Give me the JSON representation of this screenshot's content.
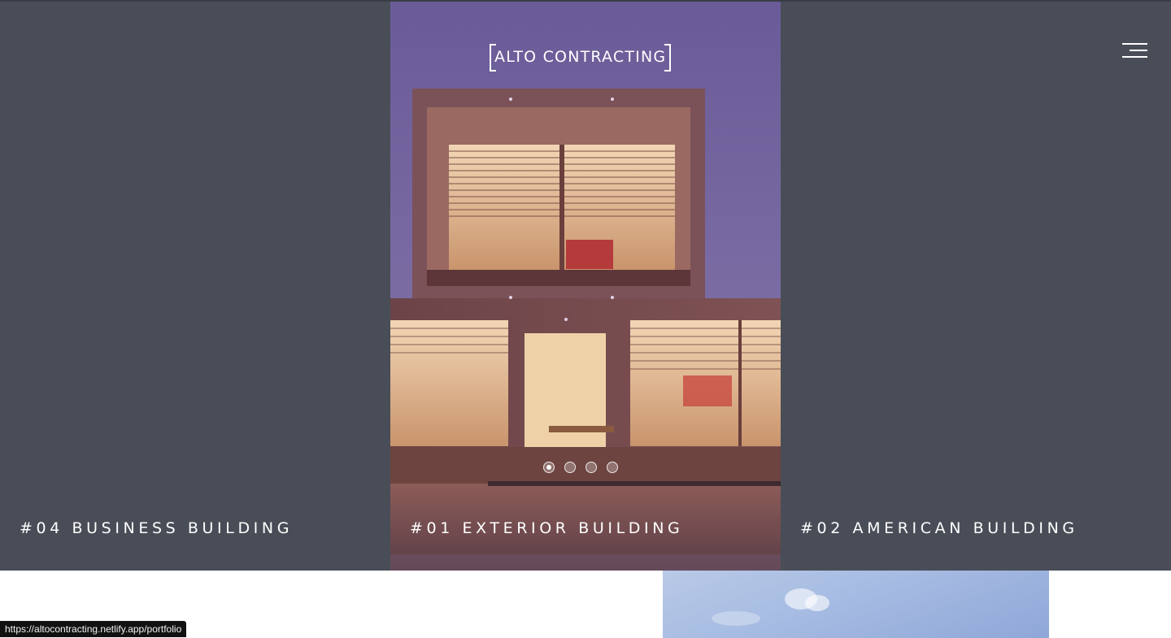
{
  "brand": {
    "logo_text": "ALTO CONTRACTING"
  },
  "header": {
    "menu_icon": "hamburger-menu-icon"
  },
  "slider": {
    "panels": [
      {
        "label": "#04 BUSINESS BUILDING"
      },
      {
        "label": "#01 EXTERIOR BUILDING"
      },
      {
        "label": "#02 AMERICAN BUILDING"
      }
    ],
    "dots": 4,
    "active_dot": 1
  },
  "status_bar": {
    "url": "https://altocontracting.netlify.app/portfolio"
  },
  "colors": {
    "panel_bg": "#494d57",
    "text": "#ffffff",
    "overlay": "#6b5a9a"
  }
}
